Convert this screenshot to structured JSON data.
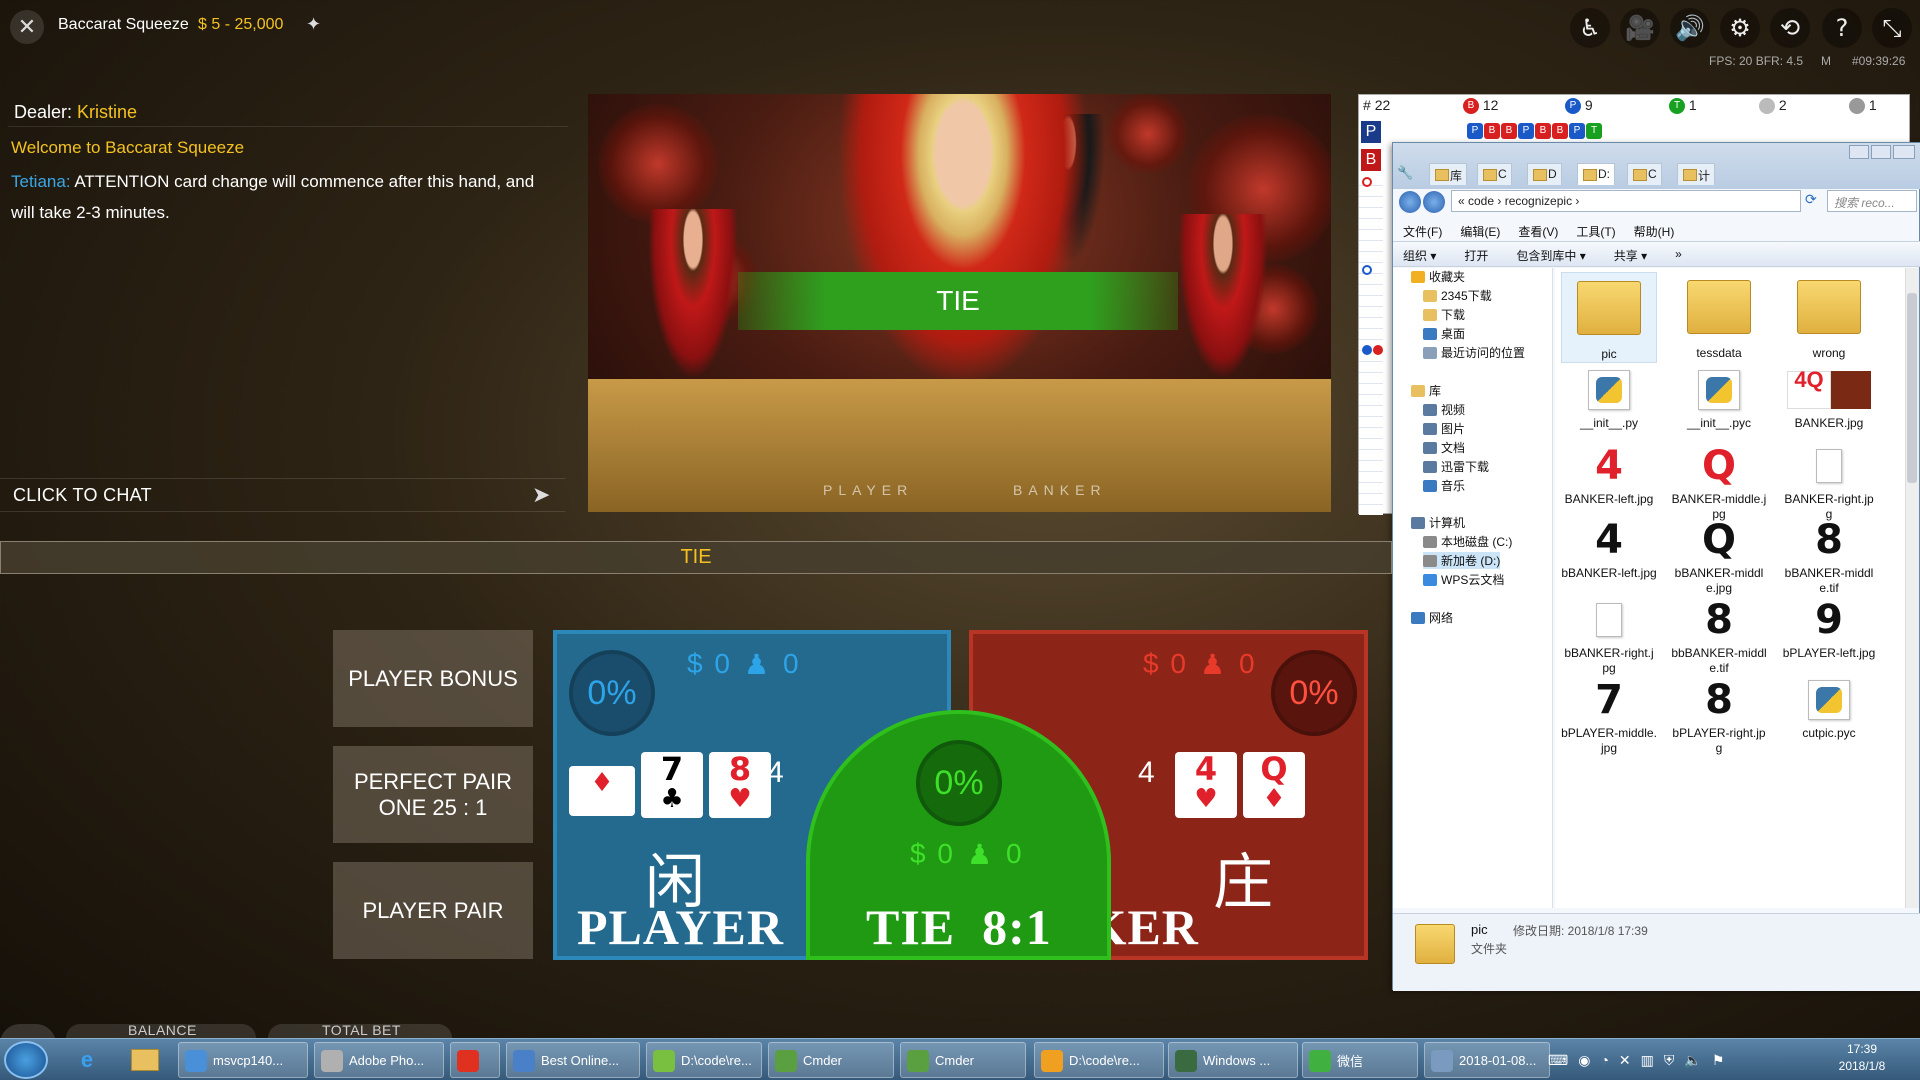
{
  "header": {
    "close_icon": "✕",
    "title": "Baccarat Squeeze",
    "limits": "$ 5 - 25,000",
    "pin_icon": "✦",
    "icons": [
      "accessibility-icon",
      "camera-icon",
      "volume-icon",
      "gear-icon",
      "history-icon",
      "help-icon",
      "fullscreen-icon"
    ],
    "icon_glyphs": [
      "♿",
      "🎥",
      "🔊",
      "⚙",
      "⟲",
      "?",
      "⤡"
    ],
    "fps": "FPS: 20 BFR: 4.5",
    "stat_m": "M",
    "round_time": "#09:39:26"
  },
  "chat": {
    "dealer_label": "Dealer:",
    "dealer_name": "Kristine",
    "welcome": "Welcome to Baccarat Squeeze",
    "msg_user": "Tetiana:",
    "msg_text": "ATTENTION card change will commence after this hand, and will take 2-3 minutes.",
    "input_label": "CLICK TO CHAT",
    "send_icon": "➤"
  },
  "video": {
    "banner": "TIE",
    "table_left": "PLAYER",
    "table_right": "BANKER"
  },
  "result": {
    "text": "TIE"
  },
  "sidebets": [
    {
      "line1": "PLAYER BONUS",
      "line2": ""
    },
    {
      "line1": "PERFECT PAIR",
      "line2": "ONE 25 : 1"
    },
    {
      "line1": "PLAYER PAIR",
      "line2": ""
    }
  ],
  "player": {
    "pct": "0%",
    "bet": "$ 0",
    "players": "0",
    "cards": [
      {
        "rank": "",
        "suit": "♦",
        "color": "red"
      },
      {
        "rank": "7",
        "suit": "♣",
        "color": "black"
      },
      {
        "rank": "8",
        "suit": "♥",
        "color": "red"
      }
    ],
    "count": "4",
    "cjk": "闲",
    "name": "PLAYER"
  },
  "tie": {
    "pct": "0%",
    "bet": "$ 0",
    "players": "0",
    "name": "TIE  8:1"
  },
  "banker": {
    "pct": "0%",
    "bet": "$ 0",
    "players": "0",
    "cards": [
      {
        "rank": "4",
        "suit": "♥",
        "color": "red"
      },
      {
        "rank": "Q",
        "suit": "♦",
        "color": "red"
      }
    ],
    "count": "4",
    "cjk": "庄",
    "name": "BANKER"
  },
  "roadmap": {
    "total": "22",
    "banker_label": "B",
    "banker_count": "12",
    "player_label": "P",
    "player_count": "9",
    "tie_label": "T",
    "tie_count": "1",
    "c5": "2",
    "c6": "1",
    "row_p": "P",
    "row_b": "B",
    "bead_row": [
      "P",
      "B",
      "B",
      "P",
      "B",
      "B",
      "P",
      "T"
    ]
  },
  "explorer": {
    "tabs": [
      "库",
      "C",
      "D",
      "D:",
      "C",
      "计"
    ],
    "address": "« code › recognizepic ›",
    "search_placeholder": "搜索 reco...",
    "menu": [
      "文件(F)",
      "编辑(E)",
      "查看(V)",
      "工具(T)",
      "帮助(H)"
    ],
    "toolbar": [
      "组织 ▾",
      "打开",
      "包含到库中 ▾",
      "共享 ▾",
      "»"
    ],
    "nav": [
      {
        "label": "收藏夹",
        "color": "#f0b020"
      },
      {
        "label": "2345下载",
        "color": "#e8c060"
      },
      {
        "label": "下载",
        "color": "#e8c060"
      },
      {
        "label": "桌面",
        "color": "#3a7ac0"
      },
      {
        "label": "最近访问的位置",
        "color": "#8aa0b8"
      },
      {
        "label": "库",
        "color": "#e8c060"
      },
      {
        "label": "视频",
        "color": "#5a7aa0"
      },
      {
        "label": "图片",
        "color": "#5a7aa0"
      },
      {
        "label": "文档",
        "color": "#5a7aa0"
      },
      {
        "label": "迅雷下载",
        "color": "#5a7aa0"
      },
      {
        "label": "音乐",
        "color": "#3a7ac0"
      },
      {
        "label": "计算机",
        "color": "#5a7aa0"
      },
      {
        "label": "本地磁盘 (C:)",
        "color": "#8a8a8a"
      },
      {
        "label": "新加卷 (D:)",
        "color": "#8a8a8a"
      },
      {
        "label": "WPS云文档",
        "color": "#3a8ae0"
      },
      {
        "label": "网络",
        "color": "#3a7ac0"
      }
    ],
    "files": [
      {
        "name": "pic",
        "kind": "folder",
        "glyph": ""
      },
      {
        "name": "tessdata",
        "kind": "folder",
        "glyph": ""
      },
      {
        "name": "wrong",
        "kind": "folder",
        "glyph": ""
      },
      {
        "name": "__init__.py",
        "kind": "py",
        "glyph": ""
      },
      {
        "name": "__init__.pyc",
        "kind": "py",
        "glyph": ""
      },
      {
        "name": "BANKER.jpg",
        "kind": "img",
        "glyph": "4Q"
      },
      {
        "name": "BANKER-left.jpg",
        "kind": "digit-red",
        "glyph": "4"
      },
      {
        "name": "BANKER-middle.jpg",
        "kind": "digit-red",
        "glyph": "Q"
      },
      {
        "name": "BANKER-right.jpg",
        "kind": "blank",
        "glyph": ""
      },
      {
        "name": "bBANKER-left.jpg",
        "kind": "digit",
        "glyph": "4"
      },
      {
        "name": "bBANKER-middle.jpg",
        "kind": "digit",
        "glyph": "Q"
      },
      {
        "name": "bBANKER-middle.tif",
        "kind": "digit",
        "glyph": "8"
      },
      {
        "name": "bBANKER-right.jpg",
        "kind": "blank",
        "glyph": ""
      },
      {
        "name": "bbBANKER-middle.tif",
        "kind": "digit",
        "glyph": "8"
      },
      {
        "name": "bPLAYER-left.jpg",
        "kind": "digit",
        "glyph": "9"
      },
      {
        "name": "bPLAYER-middle.jpg",
        "kind": "digit",
        "glyph": "7"
      },
      {
        "name": "bPLAYER-right.jpg",
        "kind": "digit",
        "glyph": "8"
      },
      {
        "name": "cutpic.pyc",
        "kind": "py",
        "glyph": ""
      }
    ],
    "details_name": "pic",
    "details_modified": "修改日期: 2018/1/8 17:39",
    "details_type": "文件夹"
  },
  "footer": {
    "balance_label": "BALANCE",
    "total_bet_label": "TOTAL BET"
  },
  "taskbar": {
    "tasks": [
      {
        "label": "msvcp140...",
        "color": "#4a90d8"
      },
      {
        "label": "Adobe Pho...",
        "color": "#b0b0b0"
      },
      {
        "label": "",
        "color": "#e03020"
      },
      {
        "label": "Best Online...",
        "color": "#4a80c8"
      },
      {
        "label": "D:\\code\\re...",
        "color": "#7ac040"
      },
      {
        "label": "Cmder",
        "color": "#5aa040"
      },
      {
        "label": "Cmder",
        "color": "#5aa040"
      },
      {
        "label": "D:\\code\\re...",
        "color": "#f0a020"
      },
      {
        "label": "Windows ...",
        "color": "#3a6a40"
      },
      {
        "label": "微信",
        "color": "#40b040"
      },
      {
        "label": "2018-01-08...",
        "color": "#7a9ac0"
      }
    ],
    "time": "17:39",
    "date": "2018/1/8"
  }
}
